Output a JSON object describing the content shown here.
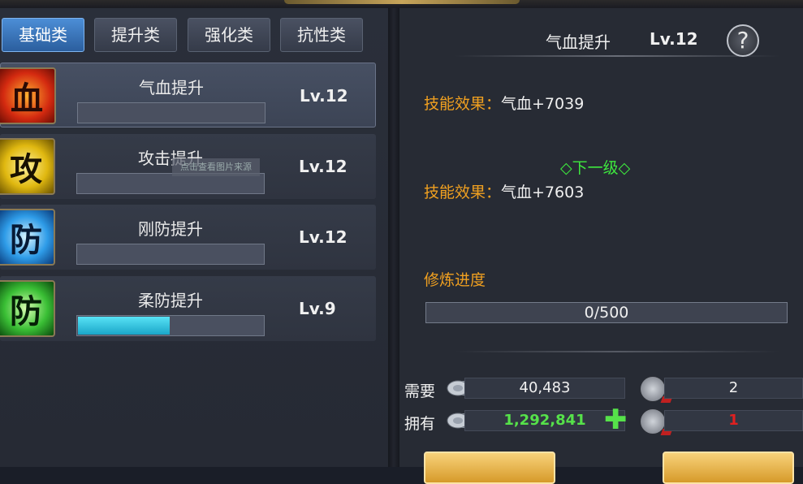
{
  "tabs": [
    "基础类",
    "提升类",
    "强化类",
    "抗性类"
  ],
  "skills": [
    {
      "name": "气血提升",
      "level": "Lv.12",
      "icon_char": "血",
      "icon": "blood-skill-icon",
      "progress": 0
    },
    {
      "name": "攻击提升",
      "level": "Lv.12",
      "icon_char": "攻",
      "icon": "attack-skill-icon",
      "progress": 0
    },
    {
      "name": "刚防提升",
      "level": "Lv.12",
      "icon_char": "防",
      "icon": "physical-defense-skill-icon",
      "progress": 0
    },
    {
      "name": "柔防提升",
      "level": "Lv.9",
      "icon_char": "防",
      "icon": "magic-defense-skill-icon",
      "progress": 0.5
    }
  ],
  "watermark": "点击查看图片来源",
  "detail": {
    "name": "气血提升",
    "level": "Lv.12",
    "help": "?",
    "effect_label": "技能效果：",
    "effect_value": "气血+7039",
    "next_label": "◇下一级◇",
    "next_effect_label": "技能效果：",
    "next_effect_value": "气血+7603",
    "progress_label": "修炼进度",
    "progress_value": "0/500"
  },
  "resources": {
    "need_label": "需要",
    "need_silver": "40,483",
    "need_token": "2",
    "have_label": "拥有",
    "have_silver": "1,292,841",
    "have_token": "1",
    "plus": "✚"
  },
  "colors": {
    "accent_orange": "#f0a020",
    "green": "#3ee83e",
    "red": "#e02020",
    "tab_active": "#3a78c0"
  }
}
